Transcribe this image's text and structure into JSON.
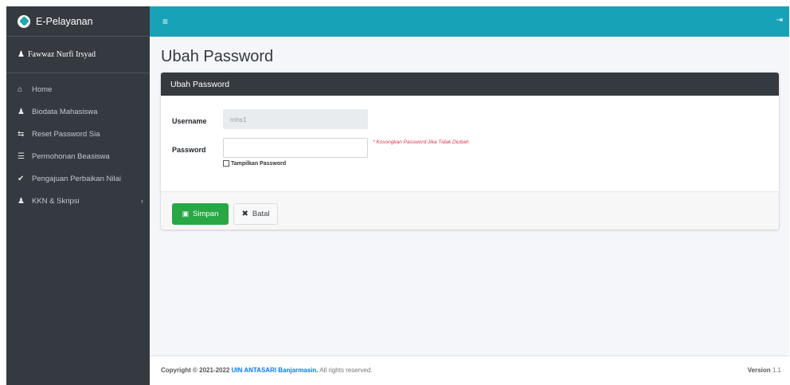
{
  "brand": {
    "title": "E-Pelayanan",
    "logo_icon": "leaf-icon"
  },
  "user": {
    "name": "Fawwaz Nurfi Irsyad",
    "icon": "user-icon"
  },
  "sidebar": {
    "items": [
      {
        "label": "Home",
        "icon": "home-icon"
      },
      {
        "label": "Biodata Mahasiswa",
        "icon": "user-icon"
      },
      {
        "label": "Reset Password Sia",
        "icon": "key-icon"
      },
      {
        "label": "Permohonan Beasiswa",
        "icon": "graduation-icon"
      },
      {
        "label": "Pengajuan Perbaikan Nilai",
        "icon": "check-circle-icon"
      },
      {
        "label": "KKN & Skripsi",
        "icon": "users-icon",
        "chevron": "‹"
      }
    ]
  },
  "topbar": {
    "menu_glyph": "≡",
    "logout_glyph": "⇥"
  },
  "page": {
    "title": "Ubah Password"
  },
  "card": {
    "header": "Ubah Password",
    "username_label": "Username",
    "username_value": "mhs1",
    "password_label": "Password",
    "password_value": "",
    "show_password_label": "Tampilkan Password",
    "hint": "* Kosongkan Password Jika Tidak Diubah",
    "save_label": "Simpan",
    "cancel_label": "Batal"
  },
  "footer": {
    "copyright_prefix": "Copyright © 2021-2022",
    "org": "UIN ANTASARI Banjarmasin.",
    "rights": "All rights reserved.",
    "version_label": "Version",
    "version_value": "1.1"
  },
  "colors": {
    "topbar": "#17a2b8",
    "sidebar": "#343a40",
    "save": "#28a745",
    "hint": "#dc3545"
  }
}
